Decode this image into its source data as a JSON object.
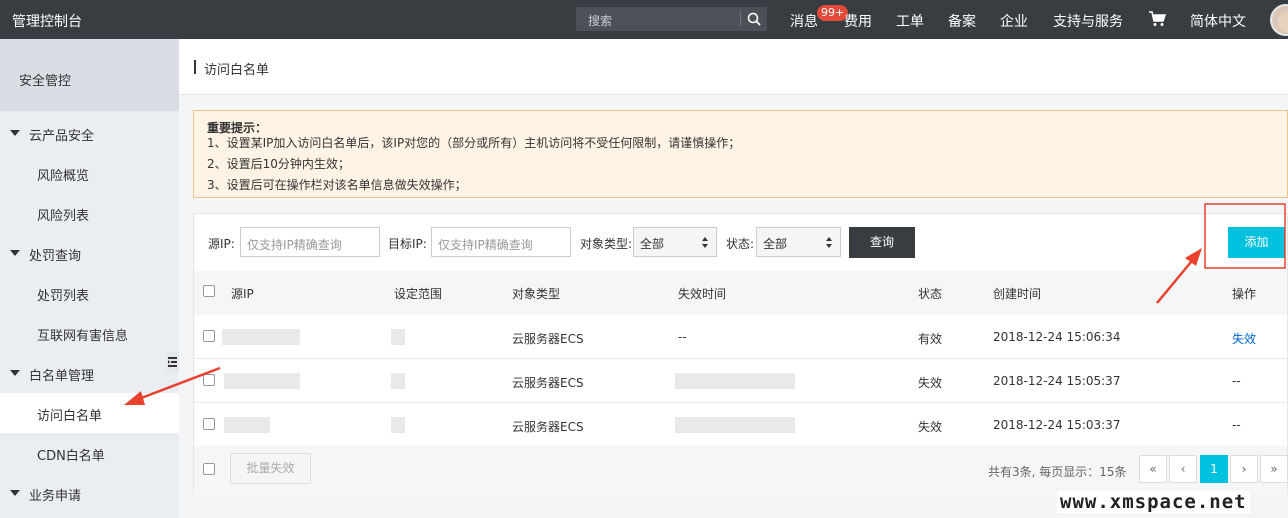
{
  "topbar": {
    "brand": "管理控制台",
    "search_placeholder": "搜索",
    "nav": [
      {
        "label": "消息"
      },
      {
        "label": "费用"
      },
      {
        "label": "工单"
      },
      {
        "label": "备案"
      },
      {
        "label": "企业"
      },
      {
        "label": "支持与服务"
      },
      {
        "label": "简体中文"
      }
    ],
    "badge": "99+",
    "icons": [
      "search-icon",
      "cart-icon",
      "avatar"
    ]
  },
  "sidebar": {
    "header": "安全管控",
    "items": [
      {
        "label": "云产品安全",
        "type": "group"
      },
      {
        "label": "风险概览",
        "type": "child"
      },
      {
        "label": "风险列表",
        "type": "child"
      },
      {
        "label": "处罚查询",
        "type": "group"
      },
      {
        "label": "处罚列表",
        "type": "child"
      },
      {
        "label": "互联网有害信息",
        "type": "child"
      },
      {
        "label": "白名单管理",
        "type": "group"
      },
      {
        "label": "访问白名单",
        "type": "child",
        "active": true
      },
      {
        "label": "CDN白名单",
        "type": "child"
      },
      {
        "label": "业务申请",
        "type": "group"
      }
    ]
  },
  "page": {
    "title": "访问白名单"
  },
  "notice": {
    "title": "重要提示：",
    "lines": [
      "1、设置某IP加入访问白名单后，该IP对您的（部分或所有）主机访问将不受任何限制，请谨慎操作；",
      "2、设置后10分钟内生效；",
      "3、设置后可在操作栏对该名单信息做失效操作；"
    ]
  },
  "filters": {
    "src_ip_label": "源IP:",
    "src_ip_placeholder": "仅支持IP精确查询",
    "dst_ip_label": "目标IP:",
    "dst_ip_placeholder": "仅支持IP精确查询",
    "type_label": "对象类型:",
    "type_value": "全部",
    "status_label": "状态:",
    "status_value": "全部",
    "query_button": "查询",
    "add_button": "添加"
  },
  "table": {
    "columns": [
      "源IP",
      "设定范围",
      "对象类型",
      "失效时间",
      "状态",
      "创建时间",
      "操作"
    ],
    "rows": [
      {
        "type": "云服务器ECS",
        "expire": "--",
        "status": "有效",
        "created": "2018-12-24 15:06:34",
        "action": "失效"
      },
      {
        "type": "云服务器ECS",
        "expire": "",
        "status": "失效",
        "created": "2018-12-24 15:05:37",
        "action": "--"
      },
      {
        "type": "云服务器ECS",
        "expire": "",
        "status": "失效",
        "created": "2018-12-24 15:03:37",
        "action": "--"
      }
    ]
  },
  "footer": {
    "batch_button": "批量失效",
    "page_info": "共有3条, 每页显示：15条",
    "pager": [
      "«",
      "‹",
      "1",
      "›",
      "»"
    ],
    "current_page": "1"
  },
  "watermark": "www.xmspace.net",
  "colors": {
    "topbar": "#373d41",
    "accent": "#00c1de",
    "link": "#0066cc",
    "annotation": "#e8412e"
  }
}
